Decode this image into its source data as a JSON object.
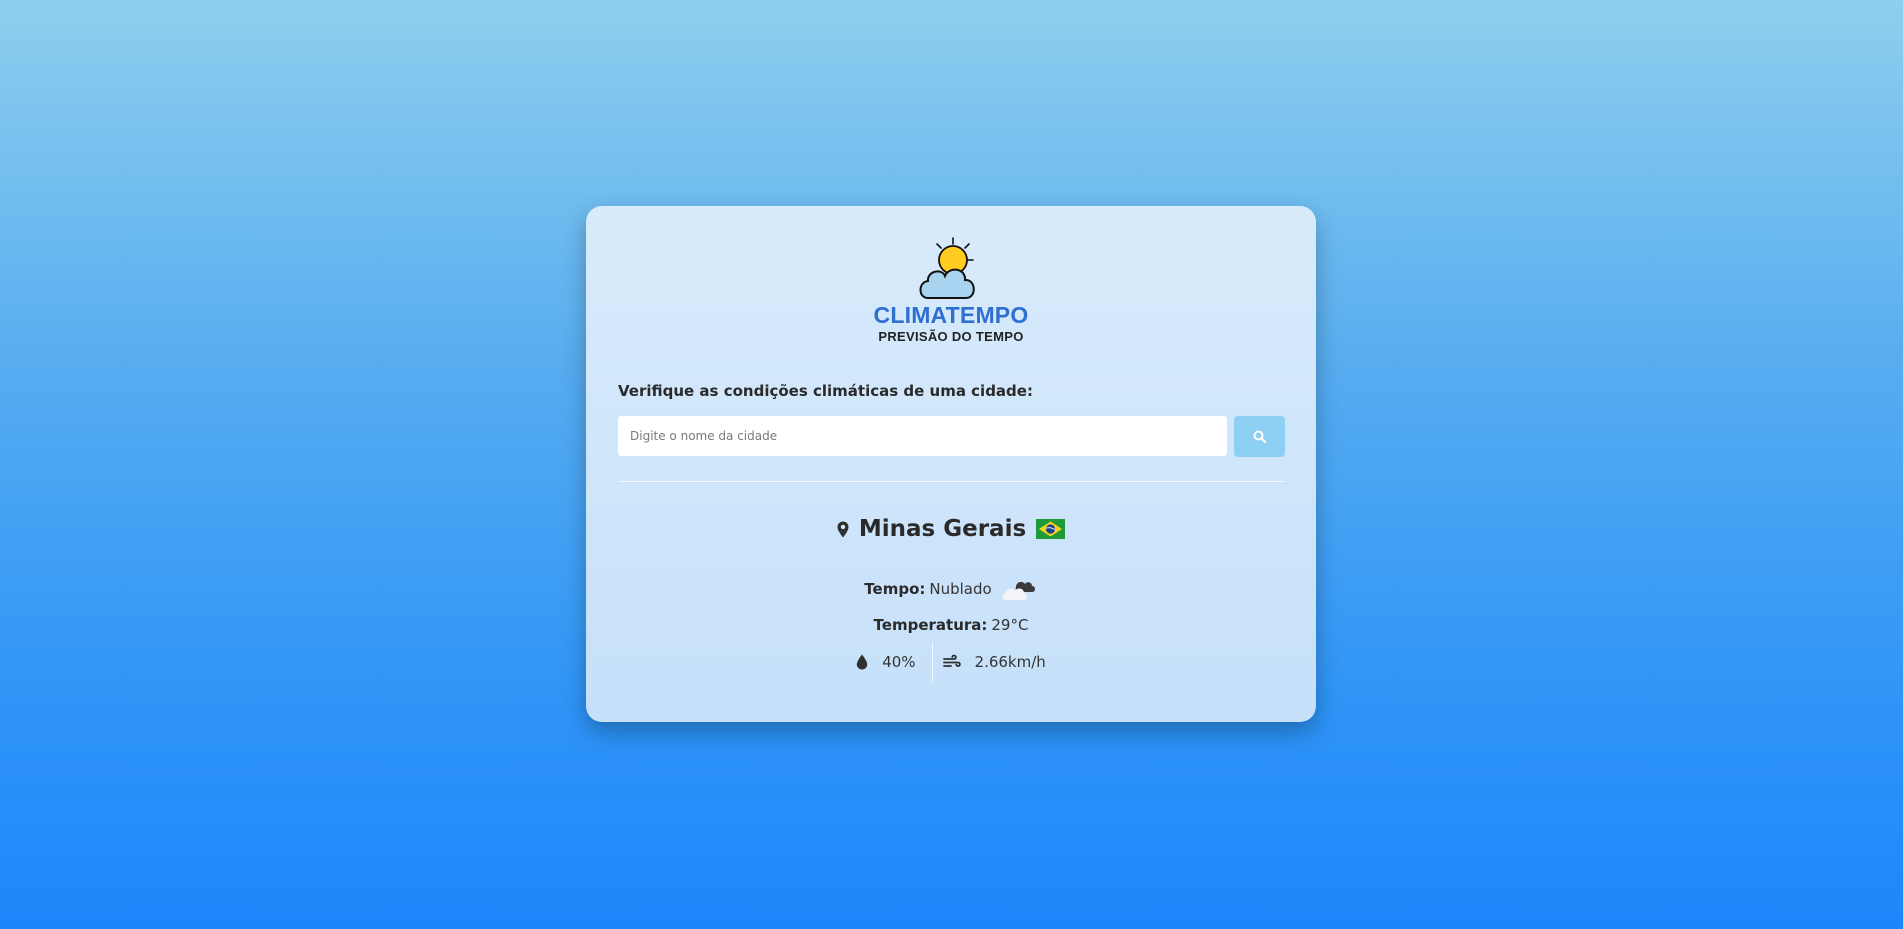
{
  "app": {
    "logo_title": "CLIMATEMPO",
    "logo_subtitle": "PREVISÃO DO TEMPO"
  },
  "search": {
    "prompt": "Verifique as condições climáticas de uma cidade:",
    "placeholder": "Digite o nome da cidade",
    "value": "",
    "button_icon": "search-icon"
  },
  "result": {
    "city": "Minas Gerais",
    "location_icon": "map-pin-icon",
    "country_flag": "brazil-flag",
    "weather_label": "Tempo:",
    "weather_value": "Nublado",
    "weather_icon": "cloud-icon",
    "temperature_label": "Temperatura:",
    "temperature_value": "29°C",
    "humidity_icon": "droplet-icon",
    "humidity": "40%",
    "wind_icon": "wind-icon",
    "wind_speed": "2.66km/h"
  },
  "colors": {
    "background_top": "#8dcfee",
    "background_bottom": "#1e86fb",
    "card": "#d2e7fb",
    "accent_blue": "#2f6fd2",
    "search_button": "#8ed0f4",
    "sun": "#ffcc1f",
    "logo_cloud": "#a8d4f2"
  }
}
